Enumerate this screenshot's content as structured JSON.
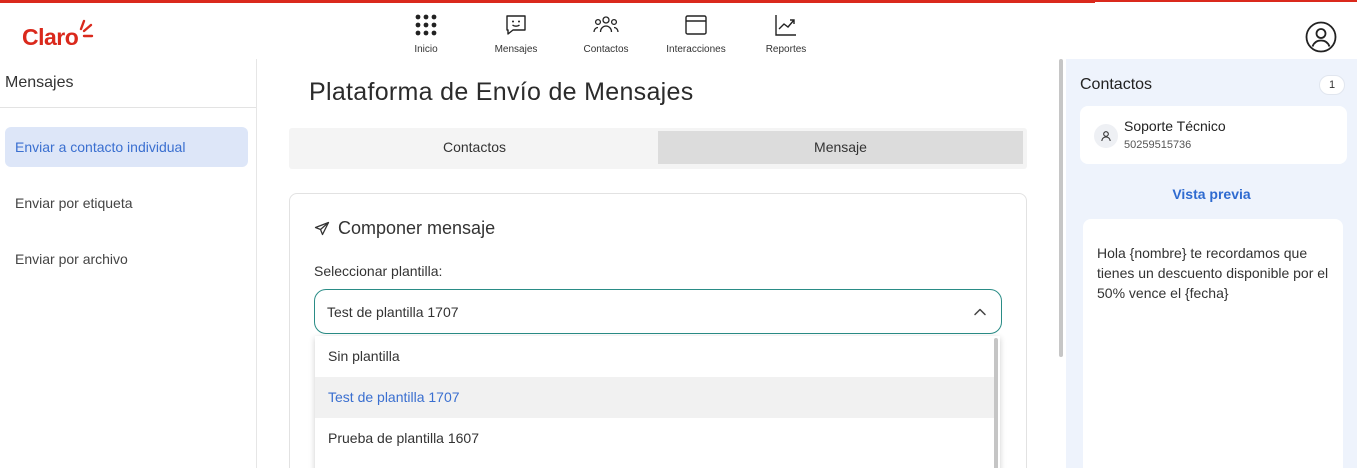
{
  "brand": {
    "logo_text": "Claro",
    "accent": "#da291c"
  },
  "nav": {
    "items": [
      {
        "label": "Inicio",
        "icon": "grid-dots-icon"
      },
      {
        "label": "Mensajes",
        "icon": "chat-smile-icon"
      },
      {
        "label": "Contactos",
        "icon": "people-group-icon"
      },
      {
        "label": "Interacciones",
        "icon": "window-icon"
      },
      {
        "label": "Reportes",
        "icon": "trend-chart-icon"
      }
    ],
    "user_icon": "user-circle-icon"
  },
  "sidebar": {
    "title": "Mensajes",
    "items": [
      {
        "label": "Enviar a contacto individual",
        "active": true
      },
      {
        "label": "Enviar por etiqueta",
        "active": false
      },
      {
        "label": "Enviar por archivo",
        "active": false
      }
    ]
  },
  "main": {
    "title": "Plataforma de Envío de Mensajes",
    "tabs": [
      {
        "label": "Contactos",
        "active": false
      },
      {
        "label": "Mensaje",
        "active": true
      }
    ],
    "compose": {
      "title": "Componer mensaje",
      "template_label": "Seleccionar plantilla:",
      "selected_template": "Test de plantilla 1707",
      "options": [
        "Sin plantilla",
        "Test de plantilla 1707",
        "Prueba de plantilla 1607"
      ]
    }
  },
  "contacts_panel": {
    "title": "Contactos",
    "count": "1",
    "contacts": [
      {
        "name": "Soporte Técnico",
        "number": "50259515736"
      }
    ],
    "preview_title": "Vista previa",
    "preview_text": "Hola {nombre} te recordamos que tienes un descuento disponible por el 50% vence el {fecha}"
  }
}
